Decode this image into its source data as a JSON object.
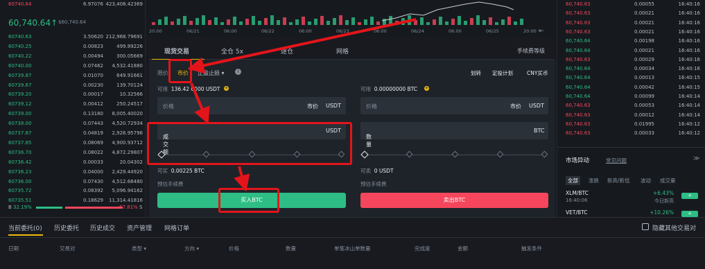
{
  "top_left": {
    "price": "60740.64",
    "amount": "6.97076",
    "total": "423,408.42369"
  },
  "orderbook": {
    "mid_price": "60,740.64",
    "mid_arrow": "↑",
    "mid_usd": "$60,740.64",
    "rows": [
      {
        "price": "60740.63",
        "amount": "3.50620",
        "total": "212,968.79691",
        "side": "buy"
      },
      {
        "price": "60740.25",
        "amount": "0.00823",
        "total": "499.89226",
        "side": "buy"
      },
      {
        "price": "60740.22",
        "amount": "0.00494",
        "total": "300.05669",
        "side": "buy"
      },
      {
        "price": "60740.00",
        "amount": "0.07462",
        "total": "4,532.41880",
        "side": "buy"
      },
      {
        "price": "60739.87",
        "amount": "0.01070",
        "total": "649.91661",
        "side": "buy"
      },
      {
        "price": "60739.67",
        "amount": "0.00230",
        "total": "139.70124",
        "side": "buy"
      },
      {
        "price": "60739.20",
        "amount": "0.00017",
        "total": "10.32566",
        "side": "buy"
      },
      {
        "price": "60739.12",
        "amount": "0.00412",
        "total": "250.24517",
        "side": "buy"
      },
      {
        "price": "60739.00",
        "amount": "0.13180",
        "total": "8,005.40020",
        "side": "buy"
      },
      {
        "price": "60738.00",
        "amount": "0.07443",
        "total": "4,520.72934",
        "side": "buy"
      },
      {
        "price": "60737.87",
        "amount": "0.04819",
        "total": "2,926.95796",
        "side": "buy"
      },
      {
        "price": "60737.85",
        "amount": "0.08069",
        "total": "4,900.93712",
        "side": "buy"
      },
      {
        "price": "60736.70",
        "amount": "0.08022",
        "total": "4,872.29807",
        "side": "buy"
      },
      {
        "price": "60736.42",
        "amount": "0.00033",
        "total": "20.04302",
        "side": "buy"
      },
      {
        "price": "60736.23",
        "amount": "0.04000",
        "total": "2,429.44920",
        "side": "buy"
      },
      {
        "price": "60736.00",
        "amount": "0.07430",
        "total": "4,512.68480",
        "side": "buy"
      },
      {
        "price": "60735.72",
        "amount": "0.08392",
        "total": "5,096.94162",
        "side": "buy"
      },
      {
        "price": "60735.51",
        "amount": "0.18629",
        "total": "11,314.41816",
        "side": "buy"
      }
    ],
    "buy_label": "B",
    "buy_pct": "32.19%",
    "buy_ratio": 0.3219,
    "sell_pct": "67.81%",
    "sell_label": "S"
  },
  "chart": {
    "dates": [
      "20:00",
      "06/21",
      "06:00",
      "06/22",
      "06:00",
      "06/23",
      "06:00",
      "06/24",
      "06:00",
      "06/25",
      "20:00"
    ],
    "reset_icon": "⇤"
  },
  "tabs": [
    {
      "label": "现货交易",
      "active": true
    },
    {
      "label": "全仓 5x",
      "active": false
    },
    {
      "label": "逐仓",
      "active": false
    },
    {
      "label": "网格",
      "active": false
    }
  ],
  "fee_tier": "手续费等级",
  "order_types": {
    "limit": "限价",
    "market": "市价",
    "stop": "止盈止损",
    "stop_arrow": "▾",
    "info": "i"
  },
  "links": {
    "transfer": "划转",
    "auto_invest": "定投计划",
    "cny": "CNY买币"
  },
  "buy": {
    "available_label": "可用",
    "available_value": "136.42  0000 USDT",
    "add": "+",
    "price_placeholder": "价格",
    "price_market": "市价",
    "price_unit": "USDT",
    "total_label": "成交额",
    "total_arrow": "▾",
    "total_unit": "USDT",
    "can_buy_label": "可买",
    "can_buy_value": "0.00225 BTC",
    "fee_label": "预估手续费",
    "button": "买入BTC"
  },
  "sell": {
    "available_label": "可用",
    "available_value": "0.00000000 BTC",
    "add": "+",
    "price_placeholder": "价格",
    "price_market": "市价",
    "price_unit": "USDT",
    "qty_label": "数量",
    "qty_arrow": "▾",
    "qty_unit": "BTC",
    "can_sell_label": "可卖",
    "can_sell_value": "0 USDT",
    "fee_label": "预估手续费",
    "button": "卖出BTC"
  },
  "trades": [
    {
      "price": "60,740.63",
      "amount": "0.00055",
      "time": "16:40:16",
      "side": "sell"
    },
    {
      "price": "60,740.63",
      "amount": "0.00021",
      "time": "16:40:16",
      "side": "sell"
    },
    {
      "price": "60,740.63",
      "amount": "0.00021",
      "time": "16:40:16",
      "side": "sell"
    },
    {
      "price": "60,740.63",
      "amount": "0.00021",
      "time": "16:40:16",
      "side": "sell"
    },
    {
      "price": "60,740.64",
      "amount": "0.00198",
      "time": "16:40:16",
      "side": "buy"
    },
    {
      "price": "60,740.64",
      "amount": "0.00021",
      "time": "16:40:16",
      "side": "buy"
    },
    {
      "price": "60,740.63",
      "amount": "0.00029",
      "time": "16:40:16",
      "side": "sell"
    },
    {
      "price": "60,740.64",
      "amount": "0.00034",
      "time": "16:40:16",
      "side": "buy"
    },
    {
      "price": "60,740.64",
      "amount": "0.00013",
      "time": "16:40:15",
      "side": "buy"
    },
    {
      "price": "60,740.64",
      "amount": "0.00042",
      "time": "16:40:15",
      "side": "buy"
    },
    {
      "price": "60,740.64",
      "amount": "0.00099",
      "time": "16:40:14",
      "side": "buy"
    },
    {
      "price": "60,740.63",
      "amount": "0.00053",
      "time": "16:40:14",
      "side": "sell"
    },
    {
      "price": "60,740.63",
      "amount": "0.00012",
      "time": "16:40:14",
      "side": "sell"
    },
    {
      "price": "60,740.63",
      "amount": "0.01995",
      "time": "16:40:12",
      "side": "sell"
    },
    {
      "price": "60,740.63",
      "amount": "0.00033",
      "time": "16:40:12",
      "side": "sell"
    }
  ],
  "market": {
    "title": "市场异动",
    "faq": "常见问题",
    "collapse": "≫",
    "tabs": [
      "全部",
      "涨跌",
      "新高/新低",
      "波动",
      "成交量"
    ],
    "items": [
      {
        "pair": "XLM/BTC",
        "time": "16:40:06",
        "change": "+6.43%",
        "desc": "今日新高",
        "badge": "+"
      },
      {
        "pair": "VET/BTC",
        "time": "16:40:05",
        "change": "+10.26%",
        "desc": "",
        "badge": "+"
      }
    ]
  },
  "bottom": {
    "tabs": [
      {
        "label": "当前委托(0)",
        "active": true
      },
      {
        "label": "历史委托",
        "active": false
      },
      {
        "label": "历史成交",
        "active": false
      },
      {
        "label": "资产管理",
        "active": false
      },
      {
        "label": "网格订单",
        "active": false
      }
    ],
    "hide_others": "隐藏其他交易对",
    "headers": [
      "日期",
      "交易对",
      "类型",
      "方向",
      "价格",
      "数量",
      "单笔冰山单数量",
      "完成度",
      "金额",
      "触发条件"
    ],
    "type_arrow": "▾",
    "dir_arrow": "▾"
  },
  "colors": {
    "buy": "#2ebd85",
    "sell": "#f6465d",
    "annotation": "#e3151a",
    "accent": "#f0b90b"
  }
}
